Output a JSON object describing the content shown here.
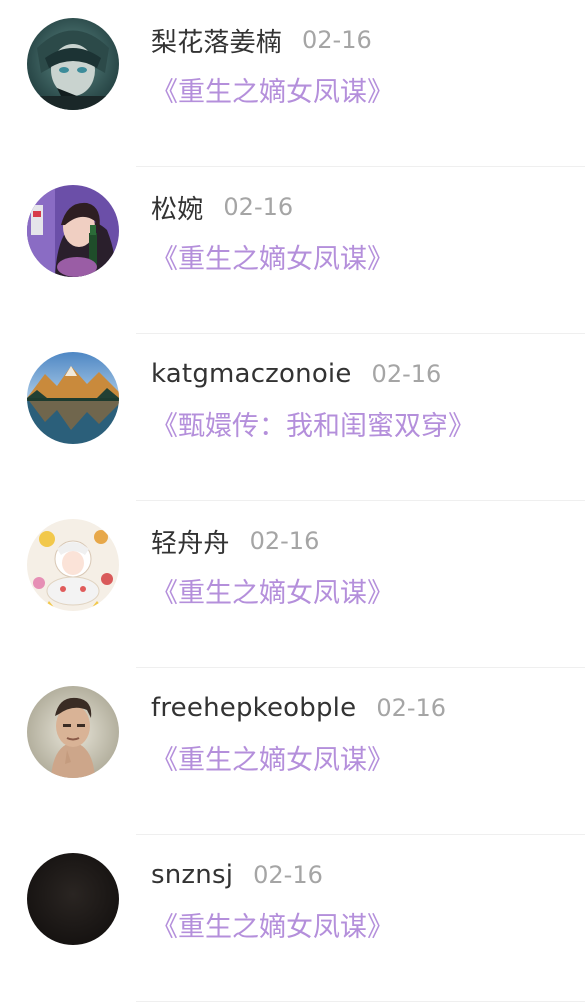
{
  "theme": {
    "book_color": "#b48fdb",
    "date_color": "#a5a5a5",
    "name_color": "#333333"
  },
  "comments": [
    {
      "username": "梨花落姜楠",
      "date": "02-16",
      "book": "《重生之嫡女凤谋》",
      "avatar_icon": "anime-character-avatar-icon"
    },
    {
      "username": "松婉",
      "date": "02-16",
      "book": "《重生之嫡女凤谋》",
      "avatar_icon": "girl-photo-avatar-icon"
    },
    {
      "username": "katgmaczonoie",
      "date": "02-16",
      "book": "《甄嬛传：我和闺蜜双穿》",
      "avatar_icon": "mountain-lake-avatar-icon"
    },
    {
      "username": "轻舟舟",
      "date": "02-16",
      "book": "《重生之嫡女凤谋》",
      "avatar_icon": "anime-illustration-avatar-icon"
    },
    {
      "username": "freehepkeobple",
      "date": "02-16",
      "book": "《重生之嫡女凤谋》",
      "avatar_icon": "man-portrait-avatar-icon"
    },
    {
      "username": "snznsj",
      "date": "02-16",
      "book": "《重生之嫡女凤谋》",
      "avatar_icon": "dark-avatar-icon"
    }
  ]
}
